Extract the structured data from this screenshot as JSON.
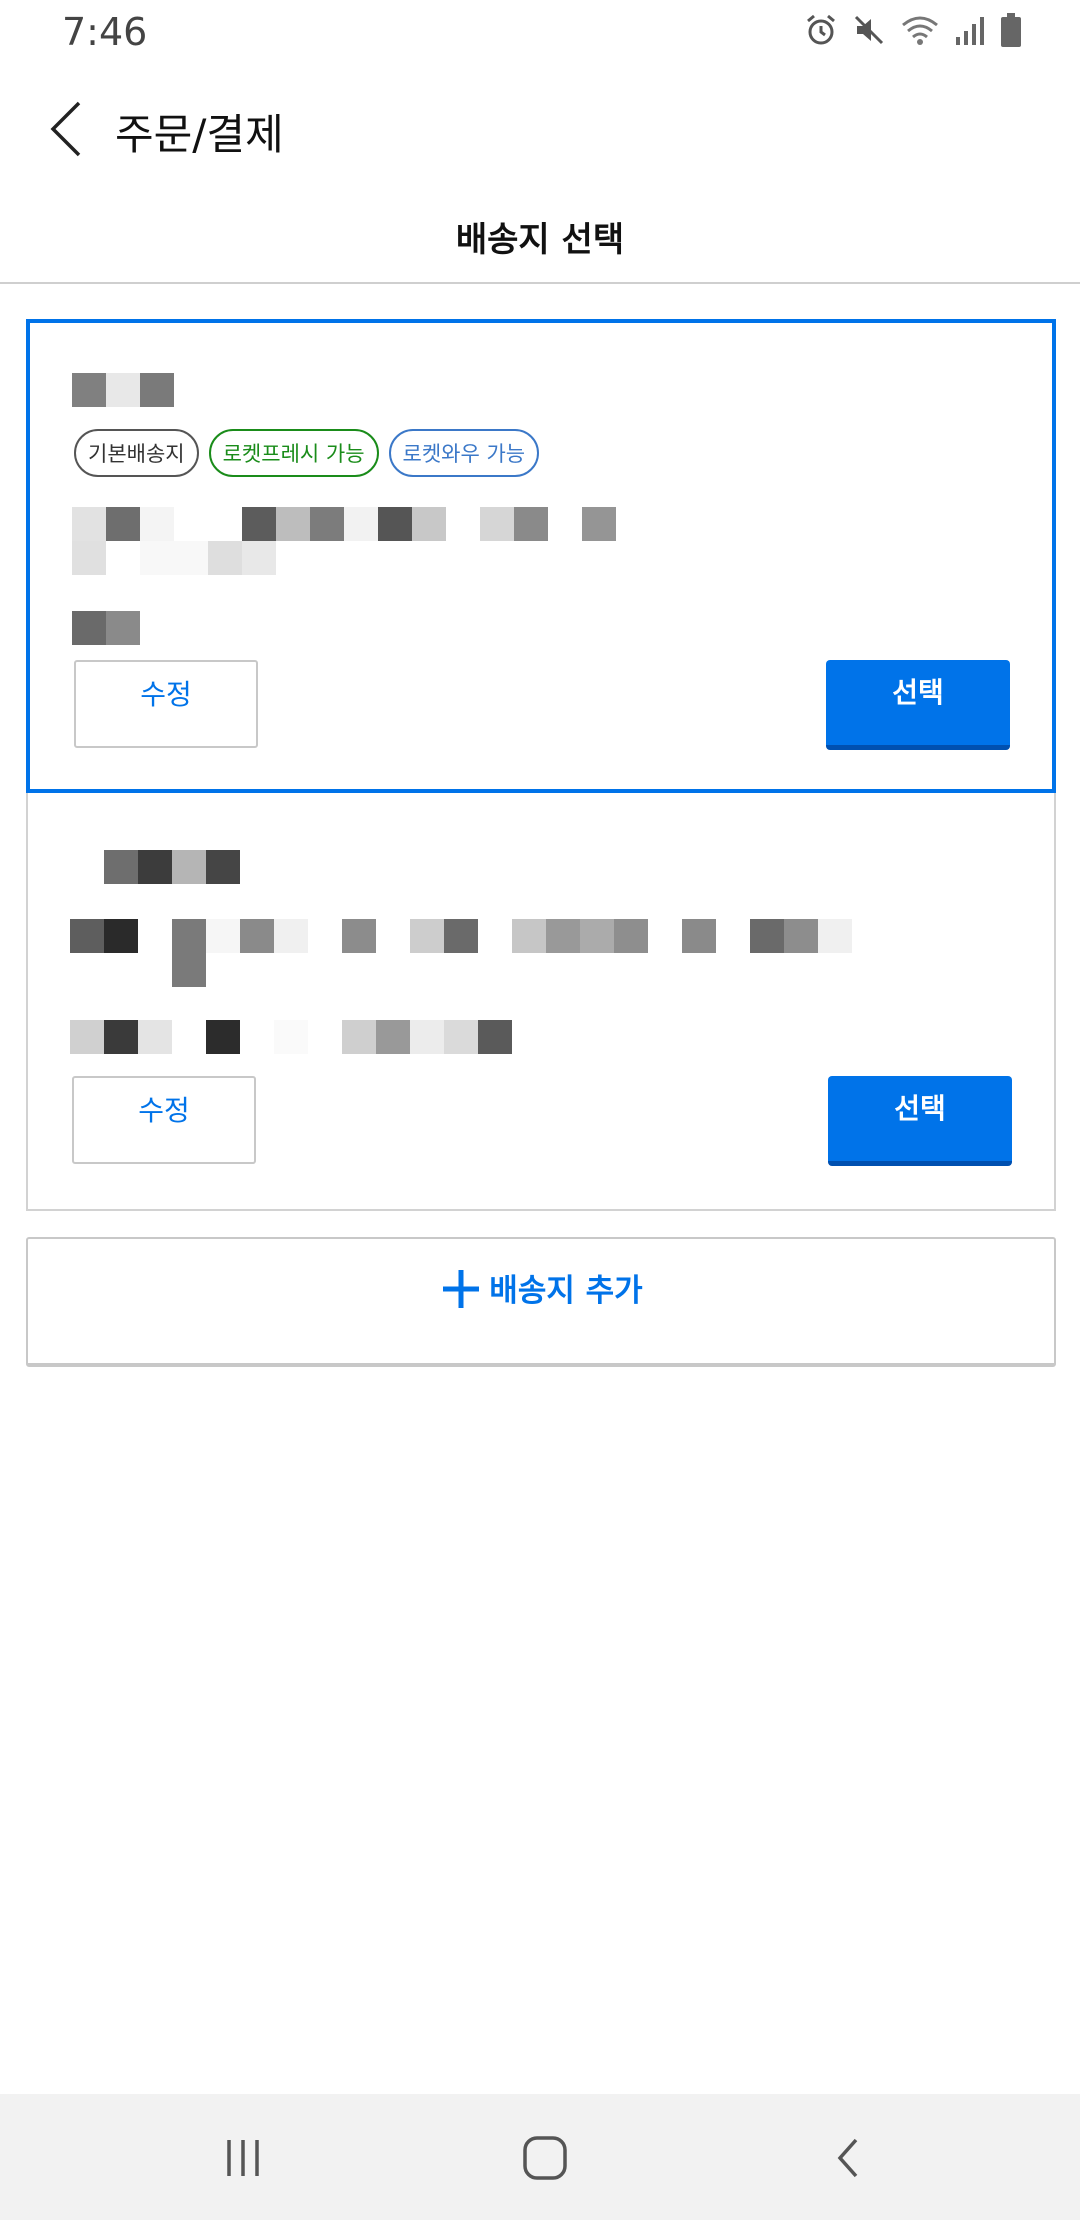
{
  "status_bar": {
    "time": "7:46",
    "icons": [
      "alarm-icon",
      "mute-icon",
      "wifi-icon",
      "signal-icon",
      "battery-icon"
    ]
  },
  "header": {
    "title": "주문/결제",
    "back_icon": "chevron-left-icon"
  },
  "subheader": {
    "title": "배송지 선택"
  },
  "addresses": [
    {
      "selected": true,
      "tags": [
        "기본배송지",
        "로켓프레시 가능",
        "로켓와우 가능"
      ],
      "edit_label": "수정",
      "select_label": "선택"
    },
    {
      "selected": false,
      "tags": [],
      "edit_label": "수정",
      "select_label": "선택"
    }
  ],
  "add_address": {
    "label": "배송지 추가",
    "icon": "plus-icon"
  },
  "colors": {
    "accent": "#0073e9",
    "fresh_tag": "#1a8c1a",
    "wow_tag": "#3b78c8"
  },
  "nav_bar": {
    "icons": [
      "recents-icon",
      "home-icon",
      "back-icon"
    ]
  }
}
